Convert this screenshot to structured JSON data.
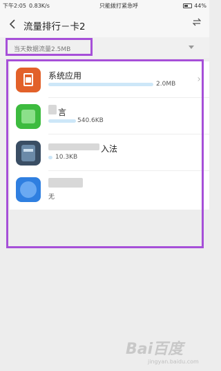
{
  "status": {
    "time": "下午2:05",
    "speed": "0.83K/s",
    "notice": "只能拨打紧急呼",
    "battery": "44%"
  },
  "header": {
    "title": "流量排行－卡2",
    "back_icon": "chevron-left-icon",
    "swap_icon": "swap-icon"
  },
  "filter": {
    "label": "当天数据流量2.5MB"
  },
  "apps": [
    {
      "name": "系统应用",
      "size": "2.0MB",
      "fraction": 1.0,
      "icon": "system-app-icon",
      "color": "#e2612a"
    },
    {
      "name": "言",
      "size": "540.6KB",
      "fraction": 0.26,
      "icon": "green-app-icon",
      "color": "#3dbb3f"
    },
    {
      "name": "入法",
      "size": "10.3KB",
      "fraction": 0.03,
      "icon": "input-method-icon",
      "color": "#3a4e64"
    },
    {
      "name": "",
      "size": "无",
      "fraction": 0,
      "icon": "blue-app-icon",
      "color": "#2f7fe0"
    }
  ],
  "watermark": {
    "brand": "Bai百度",
    "sub": "jingyan.baidu.com"
  },
  "colors": {
    "highlight": "#a64fd8",
    "bar": "#cde7f8"
  }
}
